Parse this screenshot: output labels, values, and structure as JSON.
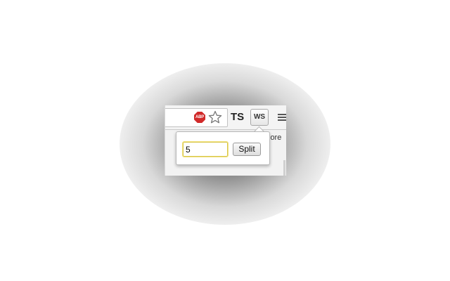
{
  "toolbar": {
    "abp_label": "ABP",
    "ts_label": "TS",
    "ws_label": "WS",
    "bookmark_fragment": "lore"
  },
  "popup": {
    "input_value": "5",
    "split_label": "Split"
  },
  "colors": {
    "abp_red": "#d12a2a",
    "input_focus": "#d7c64b"
  },
  "icons": [
    "abp-icon",
    "star-icon",
    "menu-icon"
  ]
}
